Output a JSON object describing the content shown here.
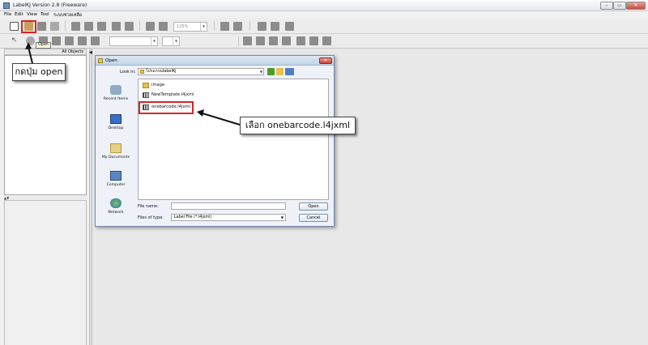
{
  "app": {
    "title": "LabelKJ Version 2.8 (Freeware)",
    "win_buttons": [
      "–",
      "▭",
      "✕"
    ]
  },
  "menu": [
    "File",
    "Edit",
    "View",
    "Tool",
    "ระบบช่วยเหลือ"
  ],
  "toolbar": {
    "zoom_value": "125%",
    "format_buttons": [
      "B",
      "I",
      "U",
      "A"
    ]
  },
  "tooltip": "Open",
  "left_panel": {
    "header": "All Objects"
  },
  "dialog": {
    "title": "Open",
    "close": "✕",
    "look_in_label": "Look in:",
    "look_in_value": "โปรแกรมlabelKj",
    "places": [
      "Recent Items",
      "Desktop",
      "My Documents",
      "Computer",
      "Network"
    ],
    "files": [
      {
        "name": "image",
        "type": "folder"
      },
      {
        "name": "NewTemplate.l4jxml",
        "type": "label"
      },
      {
        "name": "onebarcode.l4jxml",
        "type": "label"
      }
    ],
    "file_name_label": "File name:",
    "file_name_value": "",
    "file_type_label": "Files of type:",
    "file_type_value": "Label File (*.l4jxml)",
    "open_button": "Open",
    "cancel_button": "Cancel"
  },
  "annotations": {
    "press_open": "กดปุ่ม open",
    "select_file": "เลือก onebarcode.l4jxml"
  },
  "colors": {
    "highlight": "#d0262b",
    "dialog_border": "#6d8ab0"
  }
}
